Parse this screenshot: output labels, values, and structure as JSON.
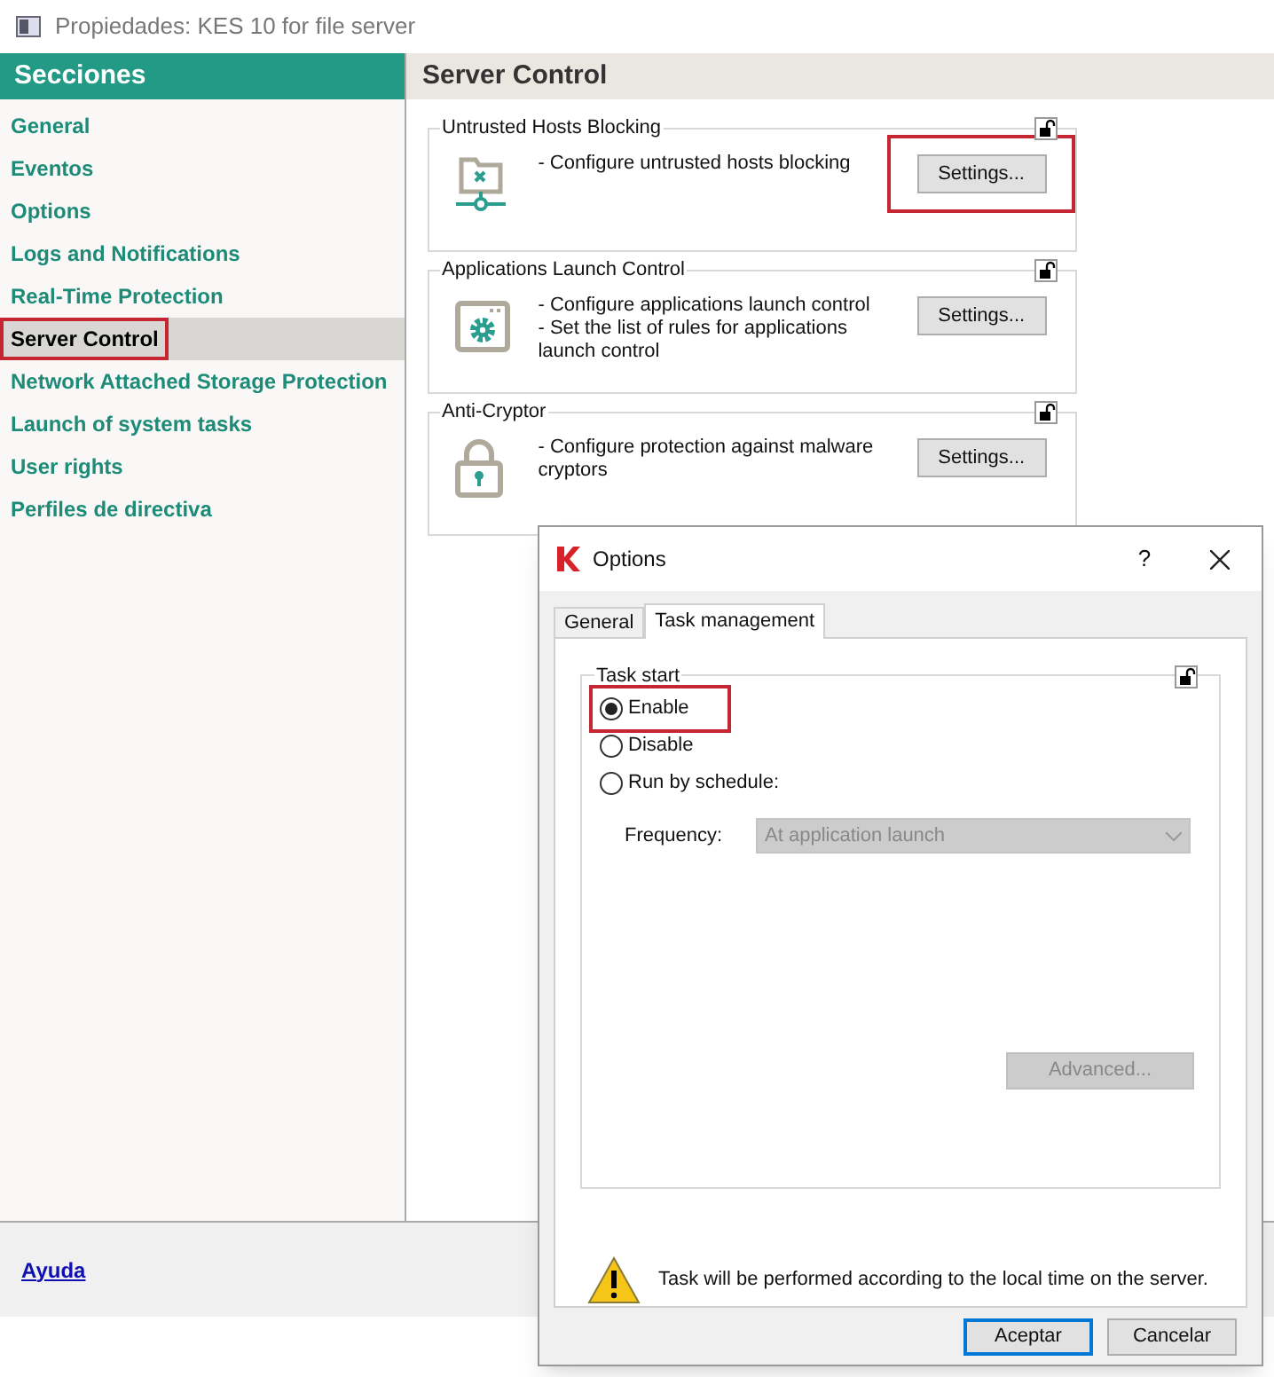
{
  "window": {
    "title": "Propiedades: KES 10 for file server"
  },
  "sidebar": {
    "header": "Secciones",
    "items": [
      {
        "label": "General",
        "selected": false,
        "highlighted": false
      },
      {
        "label": "Eventos",
        "selected": false,
        "highlighted": false
      },
      {
        "label": "Options",
        "selected": false,
        "highlighted": false
      },
      {
        "label": "Logs and Notifications",
        "selected": false,
        "highlighted": false
      },
      {
        "label": "Real-Time Protection",
        "selected": false,
        "highlighted": false
      },
      {
        "label": "Server Control",
        "selected": true,
        "highlighted": true
      },
      {
        "label": "Network Attached Storage Protection",
        "selected": false,
        "highlighted": false
      },
      {
        "label": "Launch of system tasks",
        "selected": false,
        "highlighted": false
      },
      {
        "label": "User rights",
        "selected": false,
        "highlighted": false
      },
      {
        "label": "Perfiles de directiva",
        "selected": false,
        "highlighted": false
      }
    ]
  },
  "panel": {
    "title": "Server Control",
    "groups": [
      {
        "title": "Untrusted Hosts Blocking",
        "kind": "hosts",
        "lines": [
          "- Configure untrusted hosts blocking"
        ],
        "button": "Settings...",
        "highlighted": true
      },
      {
        "title": "Applications Launch Control",
        "kind": "apps",
        "lines": [
          "- Configure applications launch control",
          "- Set the list of rules for applications launch control"
        ],
        "button": "Settings...",
        "highlighted": false
      },
      {
        "title": "Anti-Cryptor",
        "kind": "lock",
        "lines": [
          "- Configure protection against malware cryptors"
        ],
        "button": "Settings...",
        "highlighted": false
      }
    ]
  },
  "footer": {
    "link": "Ayuda"
  },
  "dialog": {
    "title": "Options",
    "help": "?",
    "tabs": [
      {
        "label": "General",
        "selected": false
      },
      {
        "label": "Task management",
        "selected": true
      }
    ],
    "group": "Task start",
    "options": [
      {
        "label": "Enable",
        "selected": true,
        "highlighted": true
      },
      {
        "label": "Disable",
        "selected": false,
        "highlighted": false
      },
      {
        "label": "Run by schedule:",
        "selected": false,
        "highlighted": false
      }
    ],
    "frequency": {
      "label": "Frequency:",
      "value": "At application launch",
      "disabled": true
    },
    "advanced": {
      "label": "Advanced...",
      "disabled": true
    },
    "note": "Task will be performed according to the local time on the server.",
    "buttons": [
      {
        "label": "Aceptar",
        "default": true
      },
      {
        "label": "Cancelar",
        "default": false
      }
    ]
  }
}
